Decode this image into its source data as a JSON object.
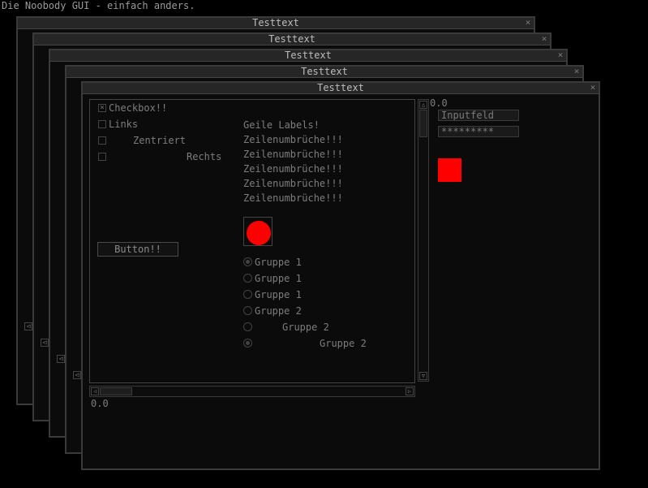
{
  "app": {
    "title": "Die Noobody GUI - einfach anders."
  },
  "windows": [
    {
      "title": "Testtext"
    },
    {
      "title": "Testtext"
    },
    {
      "title": "Testtext"
    },
    {
      "title": "Testtext"
    },
    {
      "title": "Testtext"
    }
  ],
  "icons": {
    "close": "×",
    "checkmark": "×",
    "arrow_left": "◁",
    "arrow_right": "▷",
    "arrow_up": "△",
    "arrow_down": "▽"
  },
  "colors": {
    "accent": "#ff0000"
  },
  "main": {
    "checkboxes": [
      {
        "label": "Checkbox!!",
        "checked": true
      },
      {
        "label": "Links",
        "checked": false
      },
      {
        "label": "Zentriert",
        "checked": false
      },
      {
        "label": "Rechts",
        "checked": false
      }
    ],
    "labels": [
      "Geile Labels!",
      "Zeilenumbrüche!!!",
      "Zeilenumbrüche!!!",
      "Zeilenumbrüche!!!",
      "Zeilenumbrüche!!!",
      "Zeilenumbrüche!!!"
    ],
    "button_label": "Button!!",
    "radios": [
      {
        "label": "Gruppe 1",
        "checked": true
      },
      {
        "label": "Gruppe 1",
        "checked": false
      },
      {
        "label": "Gruppe 1",
        "checked": false
      },
      {
        "label": "Gruppe 2",
        "checked": false
      },
      {
        "label": "Gruppe 2",
        "checked": false
      },
      {
        "label": "Gruppe 2",
        "checked": true
      }
    ],
    "vscroll_value": "0.0",
    "hscroll_value": "0.0",
    "input_text": "Inputfeld",
    "password_text": "*********"
  }
}
